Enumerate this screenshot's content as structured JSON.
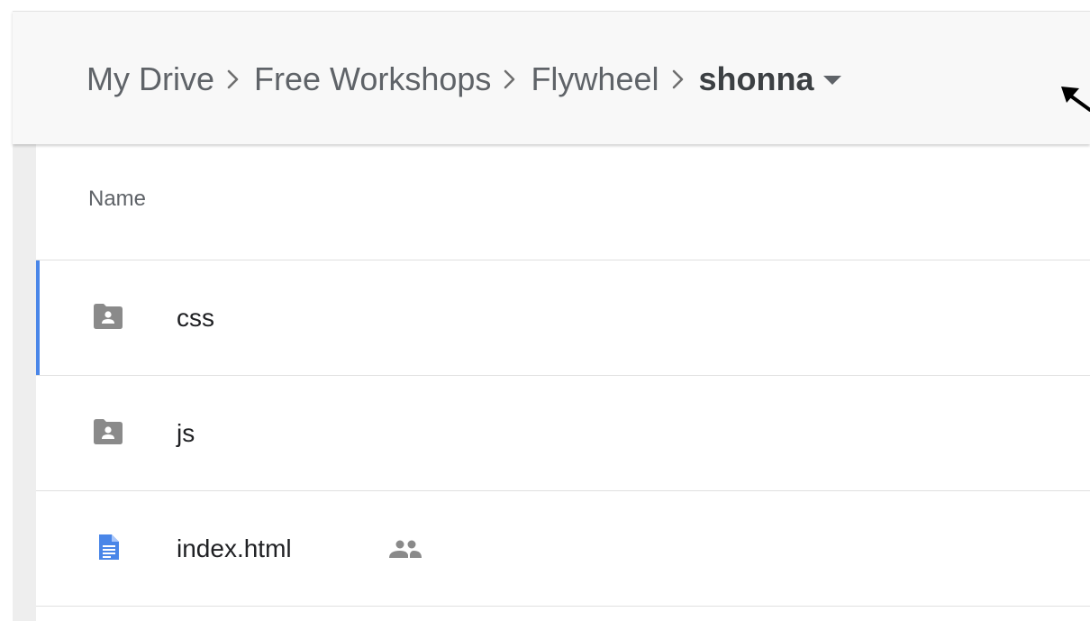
{
  "breadcrumb": {
    "items": [
      {
        "label": "My Drive"
      },
      {
        "label": "Free Workshops"
      },
      {
        "label": "Flywheel"
      },
      {
        "label": "shonna"
      }
    ],
    "separator_icon": "chevron-right-icon",
    "dropdown_icon": "caret-down-icon"
  },
  "list": {
    "header": {
      "name_label": "Name"
    },
    "rows": [
      {
        "name": "css",
        "icon": "shared-folder-icon",
        "selected": true
      },
      {
        "name": "js",
        "icon": "shared-folder-icon",
        "selected": false
      },
      {
        "name": "index.html",
        "icon": "google-doc-icon",
        "shared": true,
        "selected": false
      }
    ]
  },
  "colors": {
    "header_bg": "#f8f8f8",
    "selection_accent": "#4a86e8",
    "folder_gray": "#8a8a8a",
    "doc_blue": "#4a86e8",
    "text": "#202124"
  }
}
